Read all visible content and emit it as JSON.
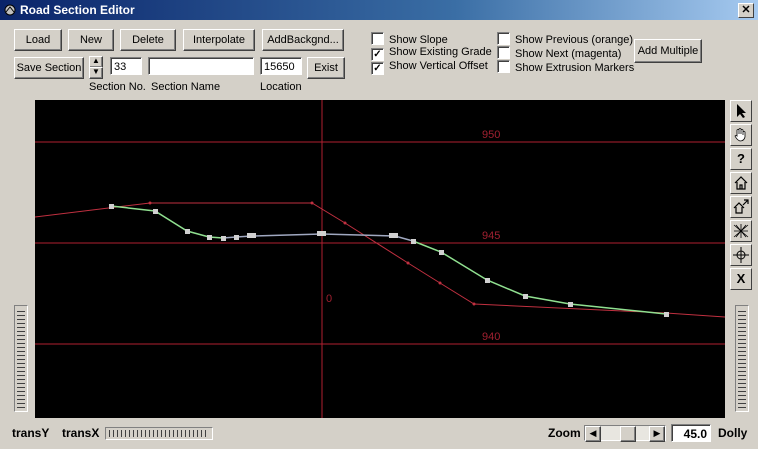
{
  "window": {
    "title": "Road Section Editor"
  },
  "toolbar": {
    "load": "Load",
    "new": "New",
    "delete": "Delete",
    "interpolate": "Interpolate",
    "add_background": "AddBackgnd...",
    "save_section": "Save Section",
    "exist": "Exist",
    "add_multiple": "Add Multiple"
  },
  "fields": {
    "section_no": "33",
    "section_name": "",
    "location": "15650"
  },
  "labels": {
    "section_no": "Section No.",
    "section_name": "Section Name",
    "location": "Location"
  },
  "checkboxes": [
    {
      "label": "Show Slope",
      "checked": false
    },
    {
      "label": "Show Existing Grade",
      "checked": true
    },
    {
      "label": "Show Vertical Offset",
      "checked": true
    },
    {
      "label": "Show Previous (orange)",
      "checked": false
    },
    {
      "label": "Show Next (magenta)",
      "checked": false
    },
    {
      "label": "Show Extrusion Markers",
      "checked": false
    }
  ],
  "plot": {
    "grid_labels": [
      "950",
      "945",
      "940"
    ],
    "center_label": "0",
    "colors": {
      "background": "#000000",
      "grid": "#b02030",
      "existing": "#c03040",
      "design": "#90e090",
      "design_flat": "#a0a8c0",
      "marker": "#d0d0d0"
    }
  },
  "side_tools": [
    {
      "name": "pointer-icon",
      "glyph": "➤"
    },
    {
      "name": "hand-icon",
      "glyph": "✋"
    },
    {
      "name": "help-icon",
      "glyph": "?"
    },
    {
      "name": "home-icon",
      "glyph": "⌂"
    },
    {
      "name": "home-zoom-icon",
      "glyph": "⌂"
    },
    {
      "name": "wireframe-icon",
      "glyph": "▦"
    },
    {
      "name": "move-icon",
      "glyph": "✥"
    },
    {
      "name": "close-x-icon",
      "glyph": "X"
    }
  ],
  "bottom": {
    "trans_y": "transY",
    "trans_x": "transX",
    "zoom_label": "Zoom",
    "zoom_value": "45.0",
    "dolly": "Dolly",
    "zoom_fraction": 0.55
  }
}
